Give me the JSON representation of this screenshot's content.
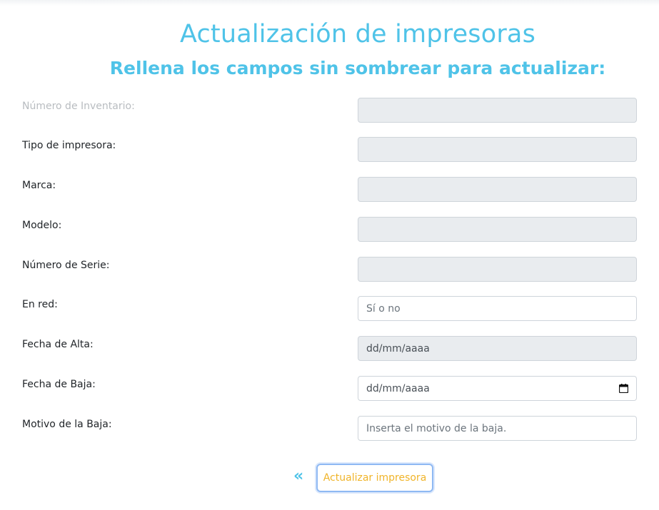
{
  "header": {
    "title": "Actualización de impresoras",
    "subtitle": "Rellena los campos sin sombrear para actualizar:"
  },
  "form": {
    "fields": [
      {
        "label": "Número de Inventario:",
        "value": "",
        "placeholder": "",
        "disabled": true,
        "label_muted": true
      },
      {
        "label": "Tipo de impresora:",
        "value": "",
        "placeholder": "",
        "disabled": true
      },
      {
        "label": "Marca:",
        "value": "",
        "placeholder": "",
        "disabled": true
      },
      {
        "label": "Modelo:",
        "value": "",
        "placeholder": "",
        "disabled": true
      },
      {
        "label": "Número de Serie:",
        "value": "",
        "placeholder": "",
        "disabled": true
      },
      {
        "label": "En red:",
        "value": "",
        "placeholder": "Sí o no",
        "disabled": false
      },
      {
        "label": "Fecha de Alta:",
        "value": "dd/mm/aaaa",
        "placeholder": "",
        "disabled": true
      },
      {
        "label": "Fecha de Baja:",
        "value": "dd/mm/aaaa",
        "placeholder": "",
        "disabled": false,
        "icon": "calendar-icon"
      },
      {
        "label": "Motivo de la Baja:",
        "value": "",
        "placeholder": "Inserta el motivo de la baja.",
        "disabled": false
      }
    ]
  },
  "actions": {
    "back_label": "«",
    "submit_label": "Actualizar impresora"
  },
  "colors": {
    "accent": "#4fc3e8",
    "button_text": "#f0b429",
    "disabled_bg": "#e9ecef"
  }
}
